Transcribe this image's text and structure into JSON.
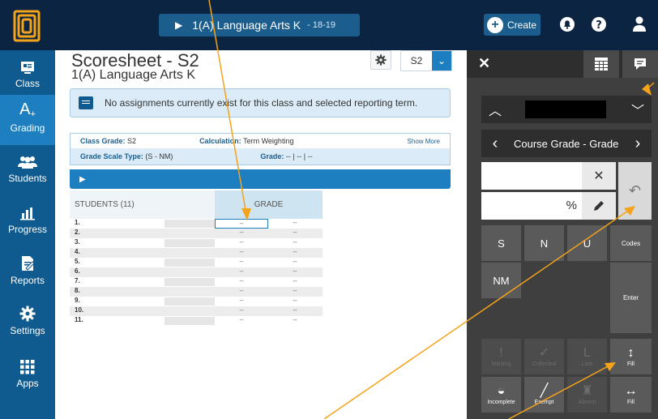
{
  "topbar": {
    "class_title": "1(A) Language Arts K",
    "year": "- 18-19",
    "create_label": "Create"
  },
  "nav": [
    {
      "label": "Class",
      "icon": "class-icon"
    },
    {
      "label": "Grading",
      "icon": "grading-icon"
    },
    {
      "label": "Students",
      "icon": "students-icon"
    },
    {
      "label": "Progress",
      "icon": "progress-icon"
    },
    {
      "label": "Reports",
      "icon": "reports-icon"
    },
    {
      "label": "Settings",
      "icon": "gear-icon"
    },
    {
      "label": "Apps",
      "icon": "apps-grid-icon"
    }
  ],
  "main": {
    "title": "Scoresheet - S2",
    "subtitle": "1(A) Language Arts K",
    "term": "S2",
    "notice": "No assignments currently exist for this class and selected reporting term.",
    "info": {
      "class_grade_label": "Class Grade:",
      "class_grade_value": "S2",
      "calculation_label": "Calculation:",
      "calculation_value": "Term Weighting",
      "show_more": "Show More",
      "scale_label": "Grade Scale Type:",
      "scale_value": "(S - NM)",
      "grade_label": "Grade:",
      "grade_value": "-- | -- | --"
    },
    "grid": {
      "students_header": "STUDENTS (11)",
      "grade_header": "GRADE",
      "rows": [
        {
          "num": "1.",
          "g1": "--",
          "g2": "--"
        },
        {
          "num": "2.",
          "g1": "--",
          "g2": "--"
        },
        {
          "num": "3.",
          "g1": "--",
          "g2": "--"
        },
        {
          "num": "4.",
          "g1": "--",
          "g2": "--"
        },
        {
          "num": "5.",
          "g1": "--",
          "g2": "--"
        },
        {
          "num": "6.",
          "g1": "--",
          "g2": "--"
        },
        {
          "num": "7.",
          "g1": "--",
          "g2": "--"
        },
        {
          "num": "8.",
          "g1": "--",
          "g2": "--"
        },
        {
          "num": "9.",
          "g1": "--",
          "g2": "--"
        },
        {
          "num": "10.",
          "g1": "--",
          "g2": "--"
        },
        {
          "num": "11.",
          "g1": "--",
          "g2": "--"
        }
      ]
    }
  },
  "panel": {
    "course_grade_label": "Course Grade - Grade",
    "percent_symbol": "%",
    "keys": {
      "S": "S",
      "N": "N",
      "U": "U",
      "codes": "Codes",
      "NM": "NM",
      "enter": "Enter",
      "missing": "Missing",
      "collected": "Collected",
      "late": "Late",
      "fill_v": "Fill",
      "incomplete": "Incomplete",
      "exempt": "Exempt",
      "absent": "Absent",
      "fill_h": "Fill"
    }
  },
  "colors": {
    "topbar": "#0b2441",
    "nav": "#0f5a8e",
    "nav_active": "#1d7fc0",
    "panel": "#3f3f3f",
    "annotation": "#f5a31a"
  }
}
